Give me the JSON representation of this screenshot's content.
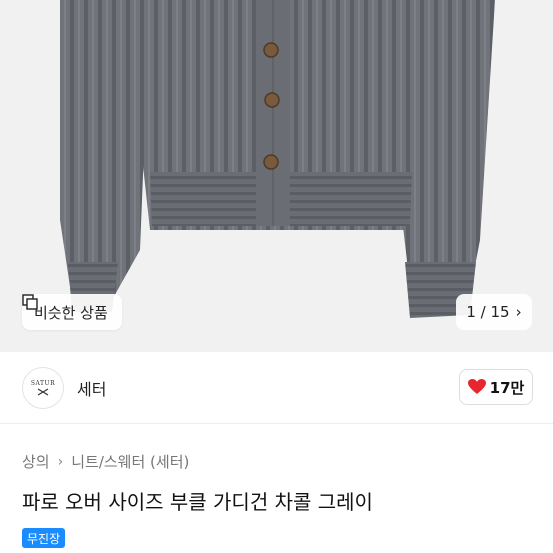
{
  "hero": {
    "image_alt": "gray ribbed knit cardigan",
    "similar_button_label": "비슷한 상품",
    "counter_text": "1 / 15"
  },
  "brand": {
    "logo_text": "SATUR",
    "name": "세터"
  },
  "like": {
    "count": "17만"
  },
  "breadcrumb": {
    "items": [
      "상의",
      "니트/스웨터 (세터)"
    ]
  },
  "product": {
    "title": "파로 오버 사이즈 부클 가디건 차콜 그레이"
  },
  "badge": {
    "label": "무진장"
  },
  "colors": {
    "accent_blue": "#1a8cff",
    "heart_red": "#e8262e",
    "cardigan_gray": "#6f7278"
  }
}
